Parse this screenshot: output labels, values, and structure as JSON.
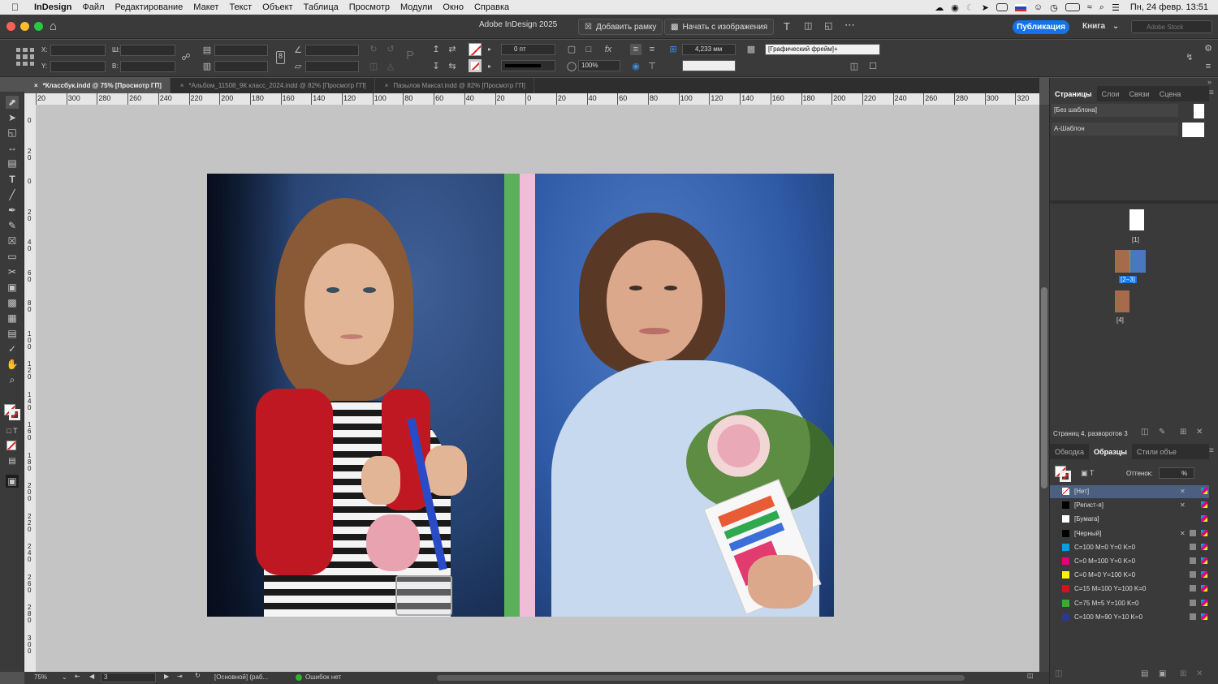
{
  "menubar": {
    "app": "InDesign",
    "items": [
      "Файл",
      "Редактирование",
      "Макет",
      "Текст",
      "Объект",
      "Таблица",
      "Просмотр",
      "Модули",
      "Окно",
      "Справка"
    ],
    "clock": "Пн, 24 февр.  13:51"
  },
  "titlebar": {
    "title": "Adobe InDesign 2025",
    "add_frame": "Добавить рамку",
    "start_image": "Начать с изображения",
    "publish": "Публикация",
    "book": "Книга",
    "stock_placeholder": "Adobe Stock"
  },
  "control": {
    "x_label": "X:",
    "y_label": "Y:",
    "w_label": "Ш:",
    "h_label": "В:",
    "stroke_weight": "0 пт",
    "scale": "100%",
    "gap": "4,233 мм",
    "object_style": "[Графический фрейм]+"
  },
  "tabs": [
    {
      "label": "*Классбук.indd @ 75% [Просмотр ГП]",
      "active": true
    },
    {
      "label": "*Альбом_11508_9К класс_2024.indd @ 82% [Просмотр ГП]",
      "active": false
    },
    {
      "label": "Пазылов Максат.indd @ 82% [Просмотр ГП]",
      "active": false
    }
  ],
  "ruler": {
    "h_ticks": [
      "20",
      "300",
      "280",
      "260",
      "240",
      "220",
      "200",
      "180",
      "160",
      "140",
      "120",
      "100",
      "80",
      "60",
      "40",
      "20",
      "0",
      "20",
      "40",
      "60",
      "80",
      "100",
      "120",
      "140",
      "160",
      "180",
      "200",
      "220",
      "240",
      "260",
      "280",
      "300",
      "320"
    ],
    "v_ticks": [
      "0",
      "20",
      "0",
      "20",
      "40",
      "60",
      "80",
      "100",
      "120",
      "140",
      "160",
      "180",
      "200",
      "220",
      "240",
      "260",
      "280",
      "300"
    ]
  },
  "status": {
    "zoom": "75%",
    "page": "3",
    "master": "[Основной] (раб...",
    "preflight": "Ошибок нет"
  },
  "pages_panel": {
    "tabs": [
      "Страницы",
      "Слои",
      "Связи",
      "Сцена"
    ],
    "masters": [
      "[Без шаблона]",
      "А-Шаблон"
    ],
    "thumbs": [
      "[1]",
      "[2–3]",
      "[4]"
    ],
    "footer": "Страниц 4, разворотов 3"
  },
  "swatches_panel": {
    "tabs": [
      "Обводка",
      "Образцы",
      "Стили объе"
    ],
    "tint_label": "Оттенок:",
    "tint_unit": "%",
    "swatches": [
      {
        "name": "[Нет]",
        "color": "#ffffff"
      },
      {
        "name": "[Регист-я]",
        "color": "#000000"
      },
      {
        "name": "[Бумага]",
        "color": "#ffffff"
      },
      {
        "name": "[Черный]",
        "color": "#000000"
      },
      {
        "name": "C=100 M=0 Y=0 K=0",
        "color": "#00a0e3"
      },
      {
        "name": "C=0 M=100 Y=0 K=0",
        "color": "#e4007c"
      },
      {
        "name": "C=0 M=0 Y=100 K=0",
        "color": "#fff200"
      },
      {
        "name": "C=15 M=100 Y=100 K=0",
        "color": "#d1131f"
      },
      {
        "name": "C=75 M=5 Y=100 K=0",
        "color": "#3aaa35"
      },
      {
        "name": "C=100 M=90 Y=10 K=0",
        "color": "#2b3990"
      }
    ]
  },
  "colors": {
    "accent": "#1473e6",
    "spine_green": "#5bb15b",
    "spine_pink": "#f0bcd8"
  }
}
